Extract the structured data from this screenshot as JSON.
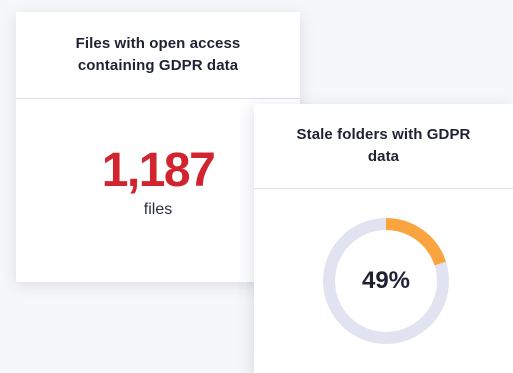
{
  "cards": {
    "open_access": {
      "title": "Files with open access containing GDPR data",
      "value": "1,187",
      "unit": "files"
    },
    "stale_folders": {
      "title": "Stale folders with GDPR data",
      "percent_label": "49%",
      "percent_value": 0.2
    }
  },
  "colors": {
    "accent_red": "#d1242f",
    "donut_fill": "#f9a43f",
    "donut_track": "#e2e3f0",
    "text_dark": "#1e2233"
  }
}
